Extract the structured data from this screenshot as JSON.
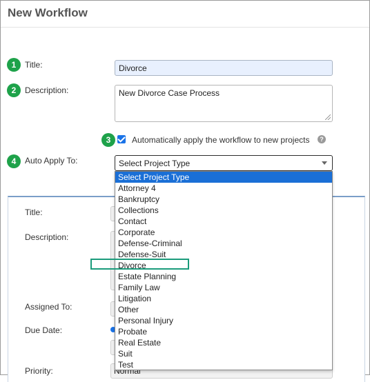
{
  "page": {
    "title": "New Workflow"
  },
  "steps": [
    "1",
    "2",
    "3",
    "4"
  ],
  "form": {
    "title_label": "Title:",
    "title_value": "Divorce",
    "description_label": "Description:",
    "description_value": "New Divorce Case Process",
    "auto_apply_checkbox_label": "Automatically apply the workflow to new projects",
    "auto_apply_checked": true,
    "auto_apply_to_label": "Auto Apply To:",
    "auto_apply_to_value": "Select Project Type",
    "help_icon_glyph": "?"
  },
  "dropdown": {
    "options": [
      "Select Project Type",
      "Attorney 4",
      "Bankruptcy",
      "Collections",
      "Contact",
      "Corporate",
      "Defense-Criminal",
      "Defense-Suit",
      "Divorce",
      "Estate Planning",
      "Family Law",
      "Litigation",
      "Other",
      "Personal Injury",
      "Probate",
      "Real Estate",
      "Suit",
      "Test"
    ],
    "selected_index": 0,
    "highlighted_option": "Divorce"
  },
  "task_panel": {
    "title_label": "Title:",
    "description_label": "Description:",
    "assigned_to_label": "Assigned To:",
    "due_date_label": "Due Date:",
    "priority_label": "Priority:",
    "priority_value": "Normal"
  },
  "colors": {
    "step_badge": "#1ea24a",
    "accent_blue": "#1a6fd6",
    "annotation_box": "#1a9b7b"
  }
}
